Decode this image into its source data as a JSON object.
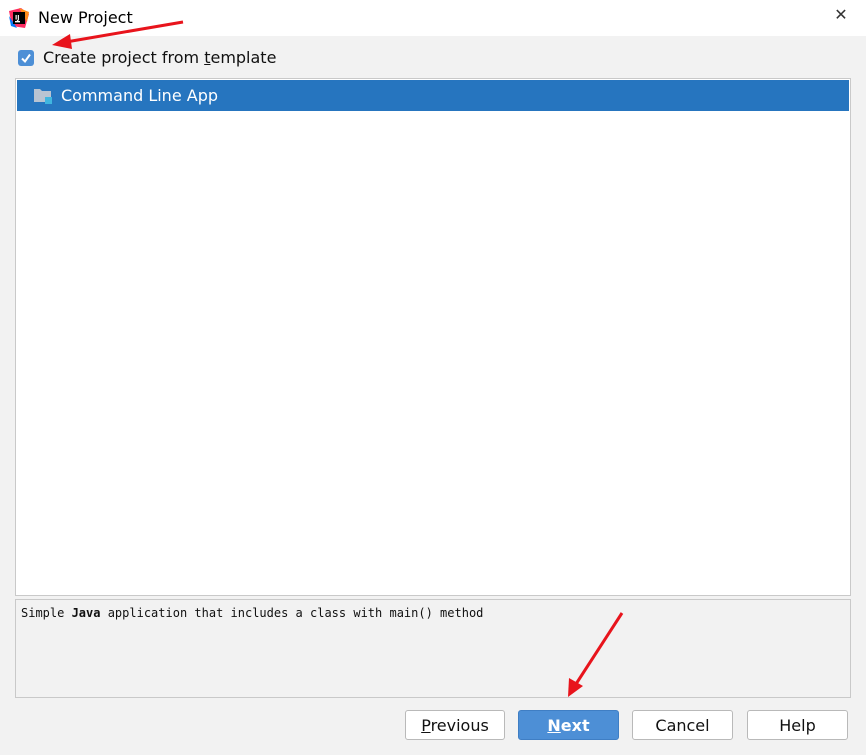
{
  "window": {
    "title": "New Project",
    "close_glyph": "✕"
  },
  "checkbox": {
    "label_before": "Create project from ",
    "label_mnemonic": "t",
    "label_after": "emplate",
    "checked": true
  },
  "templates": [
    {
      "label": "Command Line App",
      "icon": "folder-icon",
      "selected": true
    }
  ],
  "description": {
    "before": "Simple ",
    "bold": "Java",
    "after": " application that includes a class with main() method"
  },
  "buttons": {
    "previous": {
      "mnemonic": "P",
      "rest": "revious"
    },
    "next": {
      "mnemonic": "N",
      "rest": "ext"
    },
    "cancel": {
      "label": "Cancel"
    },
    "help": {
      "label": "Help"
    }
  },
  "colors": {
    "selection": "#2675bf",
    "primary_button": "#4d8fd6",
    "annotation_arrow": "#e8141c"
  }
}
